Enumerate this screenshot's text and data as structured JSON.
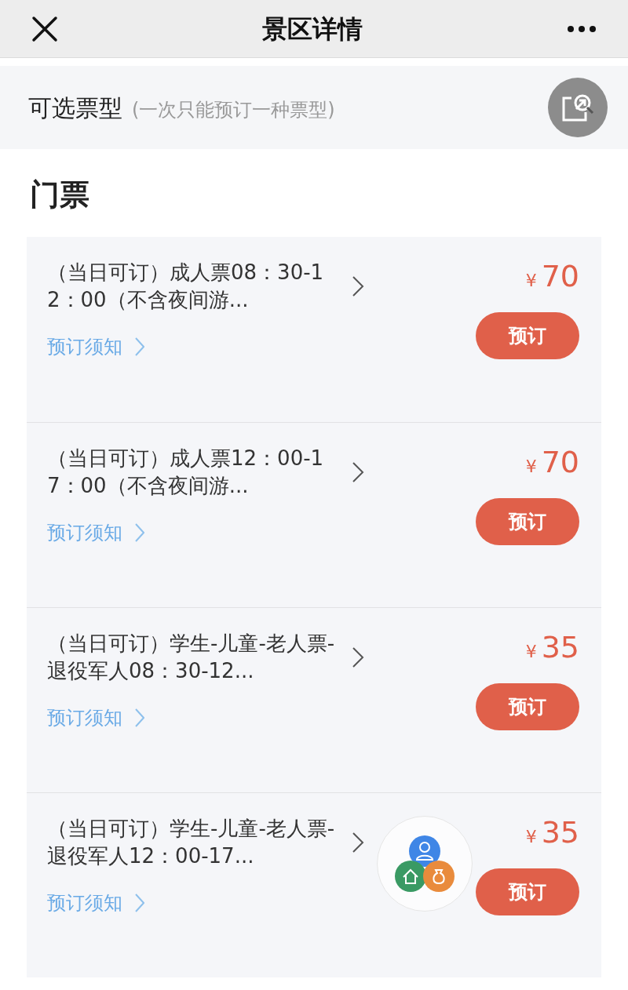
{
  "header": {
    "title": "景区详情"
  },
  "ticket_types": {
    "label": "可选票型",
    "hint": "(一次只能预订一种票型)"
  },
  "section_title": "门票",
  "tickets": [
    {
      "name": "（当日可订）成人票08：30-12：00（不含夜间游...",
      "price_symbol": "¥",
      "price": "70",
      "notice": "预订须知",
      "button": "预订"
    },
    {
      "name": "（当日可订）成人票12：00-17：00（不含夜间游...",
      "price_symbol": "¥",
      "price": "70",
      "notice": "预订须知",
      "button": "预订"
    },
    {
      "name": "（当日可订）学生-儿童-老人票-退役军人08：30-12...",
      "price_symbol": "¥",
      "price": "35",
      "notice": "预订须知",
      "button": "预订"
    },
    {
      "name": "（当日可订）学生-儿童-老人票-退役军人12：00-17...",
      "price_symbol": "¥",
      "price": "35",
      "notice": "预订须知",
      "button": "预订"
    }
  ]
}
